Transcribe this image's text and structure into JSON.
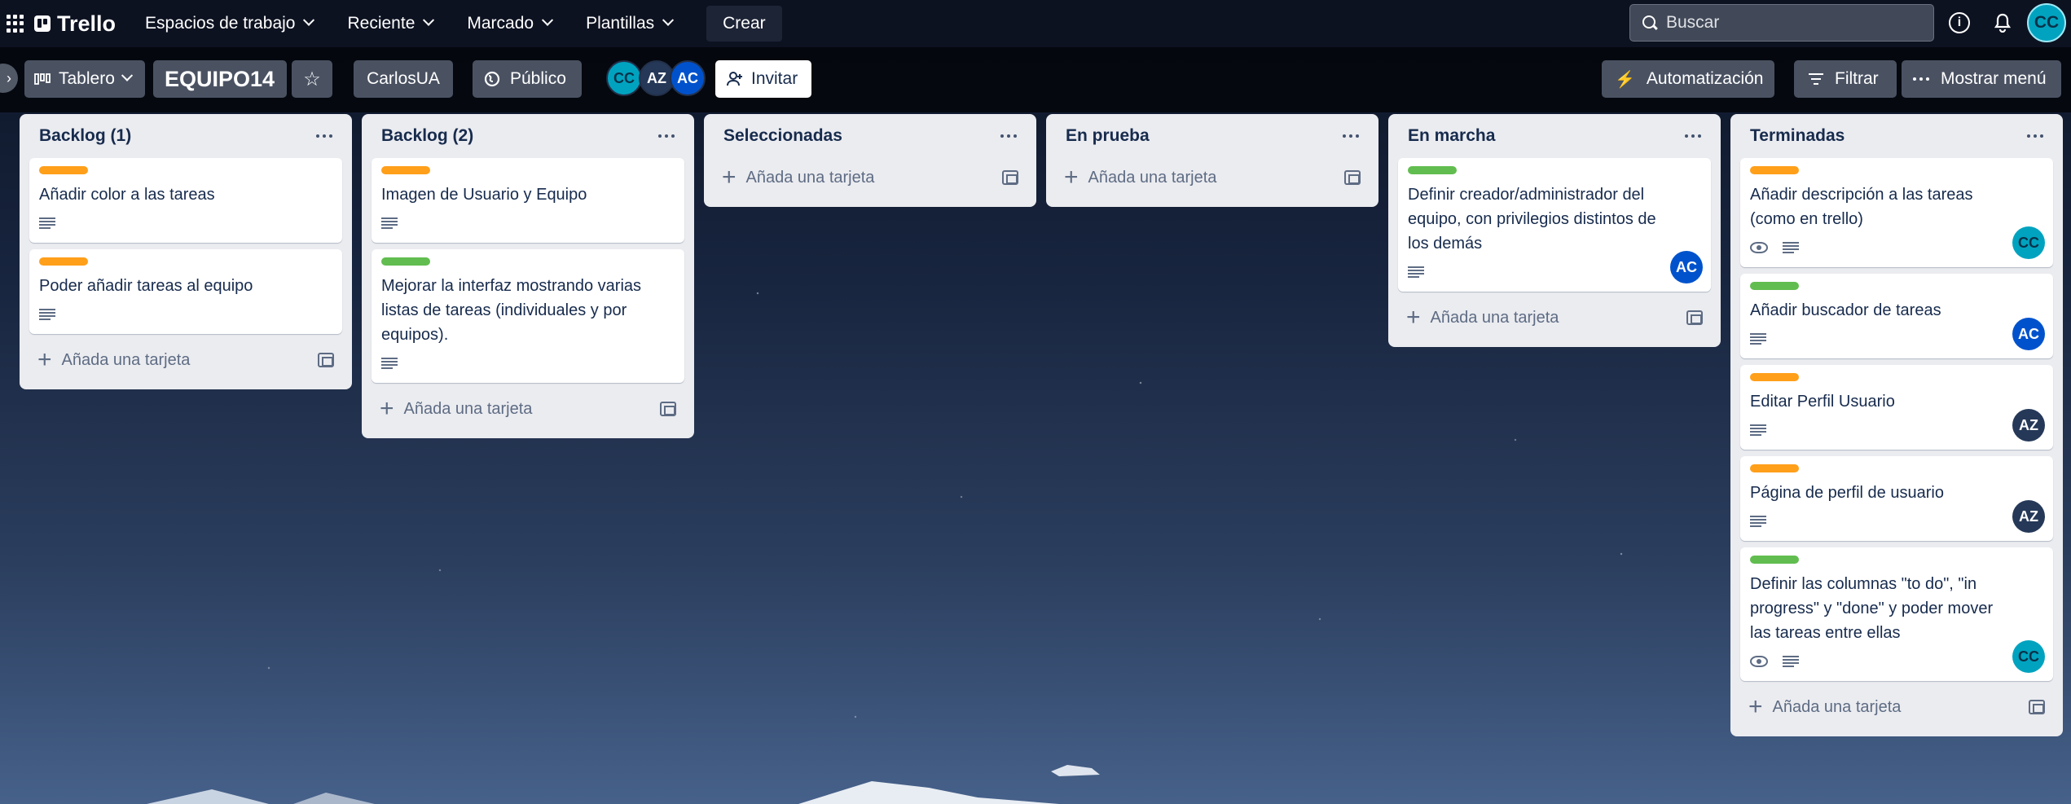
{
  "topbar": {
    "logo": "Trello",
    "nav": [
      "Espacios de trabajo",
      "Reciente",
      "Marcado",
      "Plantillas"
    ],
    "create": "Crear",
    "search_placeholder": "Buscar",
    "user_initials": "CC"
  },
  "board": {
    "view": "Tablero",
    "name": "EQUIPO14",
    "workspace": "CarlosUA",
    "visibility": "Público",
    "members": [
      "CC",
      "AZ",
      "AC"
    ],
    "invite": "Invitar",
    "automation": "Automatización",
    "filter": "Filtrar",
    "menu": "Mostrar menú"
  },
  "colors": {
    "orange": "#ff9f1a",
    "green": "#61bd4f",
    "cc": "#00a3bf",
    "ac": "#0052cc",
    "az": "#253858"
  },
  "add_card": "Añada una tarjeta",
  "lists": [
    {
      "title": "Backlog (1)",
      "cards": [
        {
          "label": "orange",
          "text": "Añadir color a las tareas",
          "desc": true
        },
        {
          "label": "orange",
          "text": "Poder añadir tareas al equipo",
          "desc": true
        }
      ]
    },
    {
      "title": "Backlog (2)",
      "cards": [
        {
          "label": "orange",
          "text": "Imagen de Usuario y Equipo",
          "desc": true
        },
        {
          "label": "green",
          "text": "Mejorar la interfaz mostrando varias listas de tareas (individuales y por equipos).",
          "desc": true
        }
      ]
    },
    {
      "title": "Seleccionadas",
      "cards": []
    },
    {
      "title": "En prueba",
      "cards": []
    },
    {
      "title": "En marcha",
      "cards": [
        {
          "label": "green",
          "text": "Definir creador/administrador del equipo, con privilegios distintos de los demás",
          "desc": true,
          "member": "AC"
        }
      ]
    },
    {
      "title": "Terminadas",
      "cards": [
        {
          "label": "orange",
          "text": "Añadir descripción a las tareas (como en trello)",
          "watch": true,
          "desc": true,
          "member": "CC"
        },
        {
          "label": "green",
          "text": "Añadir buscador de tareas",
          "desc": true,
          "member": "AC"
        },
        {
          "label": "orange",
          "text": "Editar Perfil Usuario",
          "desc": true,
          "member": "AZ"
        },
        {
          "label": "orange",
          "text": "Página de perfil de usuario",
          "desc": true,
          "member": "AZ"
        },
        {
          "label": "green",
          "text": "Definir las columnas \"to do\", \"in progress\" y \"done\" y poder mover las tareas entre ellas",
          "watch": true,
          "desc": true,
          "member": "CC"
        }
      ]
    }
  ]
}
